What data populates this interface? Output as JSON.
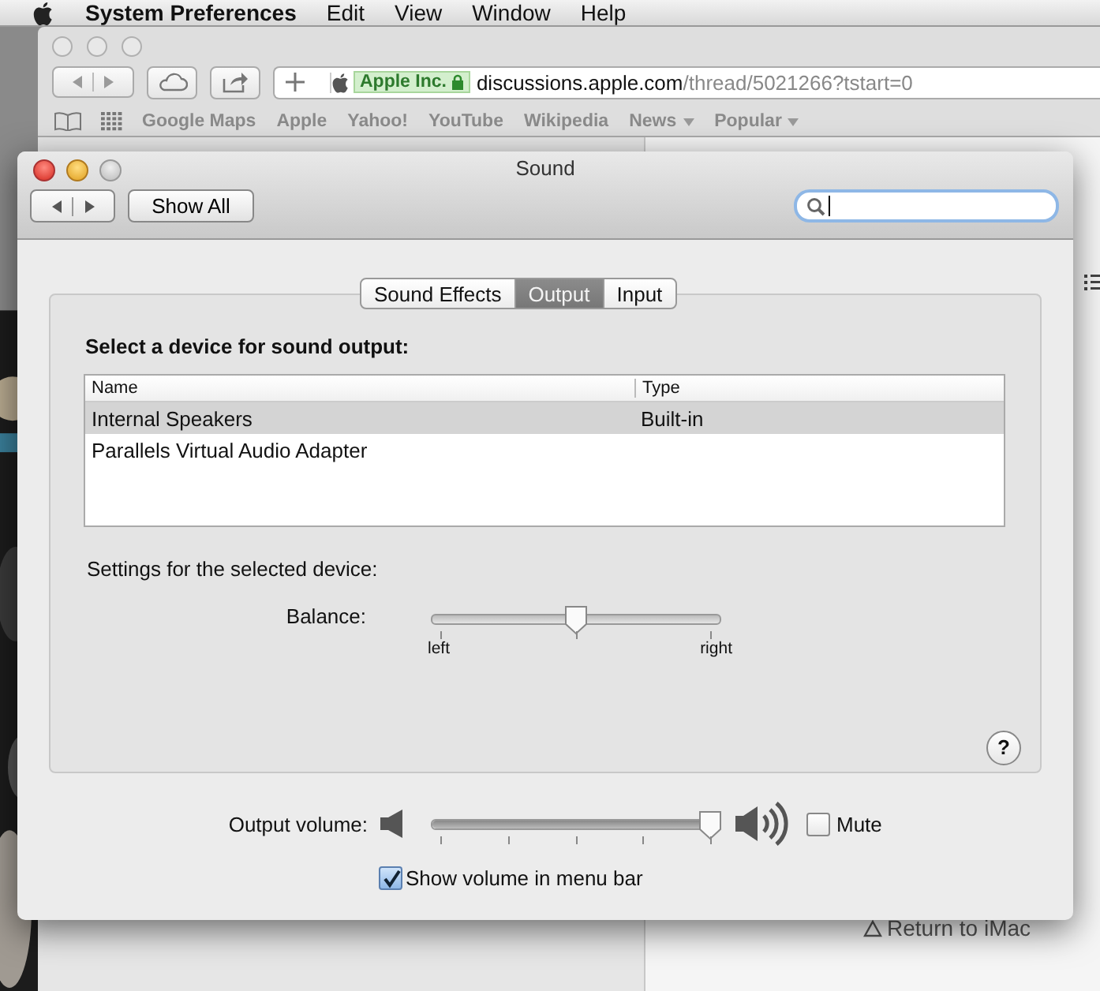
{
  "menu_bar": {
    "app": "System Preferences",
    "items": [
      "Edit",
      "View",
      "Window",
      "Help"
    ]
  },
  "browser": {
    "identity": "Apple Inc.",
    "host": "discussions.apple.com",
    "path": "/thread/5021266?tstart=0",
    "bookmarks": [
      {
        "label": "Google Maps",
        "kind": "link"
      },
      {
        "label": "Apple",
        "kind": "link"
      },
      {
        "label": "Yahoo!",
        "kind": "link"
      },
      {
        "label": "YouTube",
        "kind": "link"
      },
      {
        "label": "Wikipedia",
        "kind": "link"
      },
      {
        "label": "News",
        "kind": "menu"
      },
      {
        "label": "Popular",
        "kind": "menu"
      }
    ],
    "page_link": "Return to iMac"
  },
  "sound": {
    "title": "Sound",
    "show_all": "Show All",
    "tabs": [
      {
        "label": "Sound Effects",
        "selected": false
      },
      {
        "label": "Output",
        "selected": true
      },
      {
        "label": "Input",
        "selected": false
      }
    ],
    "heading": "Select a device for sound output:",
    "columns": [
      "Name",
      "Type"
    ],
    "rows": [
      {
        "name": "Internal Speakers",
        "type": "Built-in",
        "selected": true
      },
      {
        "name": "Parallels Virtual Audio Adapter",
        "selected": false
      }
    ],
    "settings_label": "Settings for the selected device:",
    "balance": {
      "label": "Balance:",
      "level": 0.5,
      "left": "left",
      "right": "right"
    },
    "volume": {
      "label": "Output volume:",
      "level": 0.96
    },
    "mute": {
      "label": "Mute",
      "checked": false
    },
    "help": "?",
    "menu_bar_option": {
      "label": "Show volume in menu bar",
      "checked": true
    }
  }
}
